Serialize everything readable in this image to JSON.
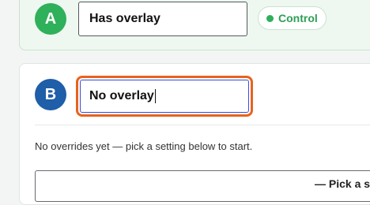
{
  "variant_a": {
    "badge": "A",
    "input_value": "Has overlay",
    "pill_label": "Control"
  },
  "variant_b": {
    "badge": "B",
    "input_value": "No overlay",
    "hint": "No overrides yet — pick a setting below to start.",
    "select_label": "— Pick a sett"
  },
  "colors": {
    "green": "#2fb05a",
    "blue": "#1f5ea8",
    "focus_orange": "#e8631c",
    "focus_inner": "#3a4bd6"
  },
  "icons": {
    "pill_dot": "status-dot-icon"
  }
}
